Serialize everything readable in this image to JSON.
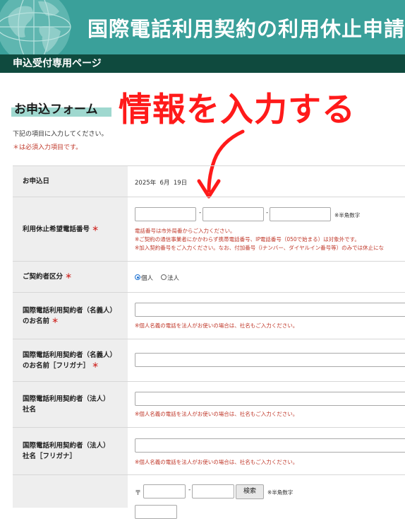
{
  "header": {
    "title": "国際電話利用契約の利用休止申請",
    "subtitle": "申込受付専用ページ"
  },
  "form": {
    "heading": "お申込フォーム",
    "annotation": "情報を入力する",
    "intro": "下記の項目に入力してください。",
    "required_note": "＊は必須入力項目です。",
    "required_mark": "＊"
  },
  "fields": {
    "application_date": {
      "label": "お申込日",
      "value": "2025年  6月  19日"
    },
    "phone_number": {
      "label": "利用休止希望電話番号",
      "dash": "-",
      "hint": "※半角数字",
      "notes": [
        "電話番号は市外局番からご入力ください。",
        "※ご契約の通信事業者にかかわらず携帯電話番号、IP電話番号（050で始まる）は対象外です。",
        "※加入契約番号をご入力ください。なお、付加番号（iナンバー、ダイヤルイン番号等）のみでは休止にな"
      ]
    },
    "contractor_type": {
      "label": "ご契約者区分",
      "options": [
        "個人",
        "法人"
      ],
      "selected": "個人"
    },
    "personal_name": {
      "label_line1": "国際電話利用契約者（名義人）",
      "label_line2": "のお名前",
      "note": "※個人名義の電話を法人がお使いの場合は、社名もご入力ください。"
    },
    "personal_name_kana": {
      "label_line1": "国際電話利用契約者（名義人）",
      "label_line2": "のお名前［フリガナ］"
    },
    "company_name": {
      "label_line1": "国際電話利用契約者（法人）",
      "label_line2": "社名",
      "note": "※個人名義の電話を法人がお使いの場合は、社名もご入力ください。"
    },
    "company_name_kana": {
      "label_line1": "国際電話利用契約者（法人）",
      "label_line2": "社名［フリガナ］",
      "note": "※個人名義の電話を法人がお使いの場合は、社名もご入力ください。"
    },
    "postal_code": {
      "prefix": "〒",
      "dash": "-",
      "search_button": "検索",
      "hint": "※半角数字"
    }
  }
}
